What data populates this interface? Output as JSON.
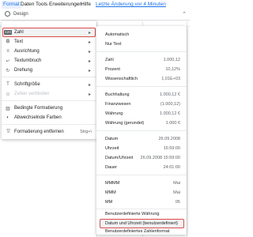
{
  "menubar": {
    "items": [
      "Format",
      "Daten",
      "Tools",
      "Erweiterungen",
      "Hilfe"
    ],
    "last_edit": "Letzte Änderung vor 4 Minuten"
  },
  "toolbar": {
    "design_label": "Design",
    "collapse_glyph": "⌃"
  },
  "format_menu": {
    "items": [
      {
        "label": "Zahl",
        "icon": "123-badge-icon",
        "submenu": true
      },
      {
        "label": "Text",
        "icon": "bold-b-icon",
        "submenu": true
      },
      {
        "label": "Ausrichtung",
        "icon": "align-left-icon",
        "submenu": true
      },
      {
        "label": "Textumbruch",
        "icon": "wrap-icon",
        "submenu": true
      },
      {
        "label": "Drehung",
        "icon": "rotate-icon",
        "submenu": true
      },
      {
        "label": "Schriftgröße",
        "icon": "font-size-icon",
        "submenu": true
      },
      {
        "label": "Zellen verbinden",
        "icon": "merge-icon",
        "submenu": true,
        "disabled": true
      },
      {
        "label": "Bedingte Formatierung",
        "icon": "conditional-format-icon"
      },
      {
        "label": "Abwechselnde Farben",
        "icon": "alternating-colors-icon"
      },
      {
        "label": "Formatierung entfernen",
        "icon": "clear-format-icon",
        "shortcut": "Strg+\\"
      }
    ],
    "badge_text": "123"
  },
  "number_submenu": {
    "items": [
      {
        "name": "Automatisch",
        "example": ""
      },
      {
        "name": "Nur Text",
        "example": ""
      },
      {
        "name": "Zahl",
        "example": "1.000,12"
      },
      {
        "name": "Prozent",
        "example": "10,12%"
      },
      {
        "name": "Wissenschaftlich",
        "example": "1,01E+03"
      },
      {
        "name": "Buchhaltung",
        "example": "1.000,12 €"
      },
      {
        "name": "Finanzwesen",
        "example": "(1.000,12)"
      },
      {
        "name": "Währung",
        "example": "1.000,12 €"
      },
      {
        "name": "Währung (gerundet)",
        "example": "1.000 €"
      },
      {
        "name": "Datum",
        "example": "26.09.2008"
      },
      {
        "name": "Uhrzeit",
        "example": "15:59:00"
      },
      {
        "name": "Datum/Uhrzeit",
        "example": "26.09.2008 15:59:00"
      },
      {
        "name": "Dauer",
        "example": "24:01:00"
      },
      {
        "name": "MMMM",
        "example": "Mai"
      },
      {
        "name": "MMM",
        "example": "Mai"
      },
      {
        "name": "MM",
        "example": "05"
      },
      {
        "name": "Benutzerdefinierte Währung",
        "example": ""
      },
      {
        "name": "Datum und Uhrzeit (benutzerdefiniert)",
        "example": ""
      },
      {
        "name": "Benutzerdefiniertes Zahlenformat",
        "example": ""
      }
    ]
  },
  "colors": {
    "highlight_border": "#d94c4c",
    "accent": "#1a73e8"
  }
}
